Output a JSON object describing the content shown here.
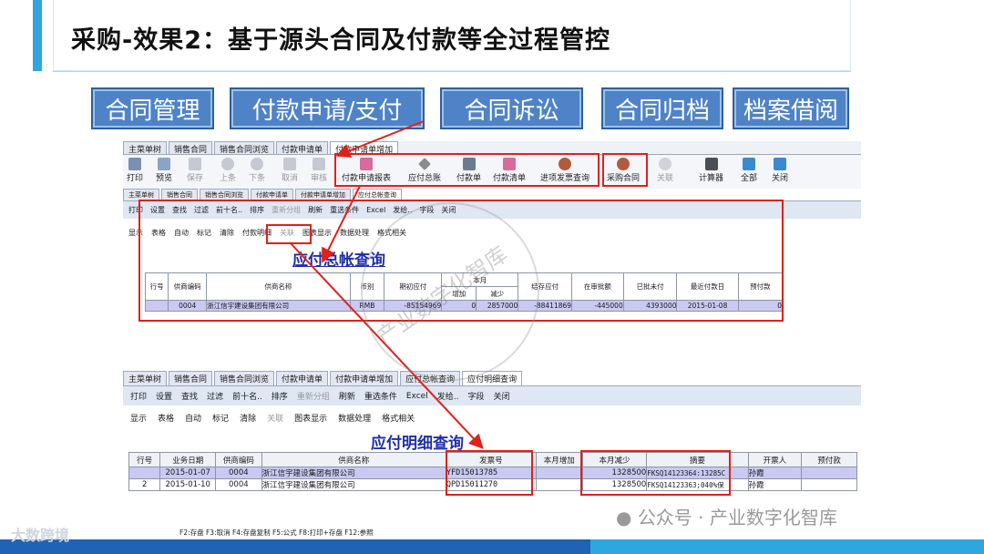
{
  "title": "采购-效果2：基于源头合同及付款等全过程管控",
  "modules": [
    "合同管理",
    "付款申请/支付",
    "合同诉讼",
    "合同归档",
    "档案借阅"
  ],
  "win1": {
    "tabs": [
      "主菜单树",
      "销售合同",
      "销售合同浏览",
      "付款申请单",
      "付款申请单增加"
    ],
    "tools_left": [
      {
        "label": "打印",
        "dis": false
      },
      {
        "label": "预览",
        "dis": false
      },
      {
        "label": "保存",
        "dis": true
      },
      {
        "label": "上条",
        "dis": true
      },
      {
        "label": "下条",
        "dis": true
      },
      {
        "label": "取消",
        "dis": true
      },
      {
        "label": "审核",
        "dis": true
      }
    ],
    "tools_group": [
      "付款申请报表",
      "应付总账",
      "付款单",
      "付款清单",
      "进项发票查询"
    ],
    "tool_purchase": "采购合同",
    "tools_right": [
      "关联",
      "计算器",
      "全部",
      "关闭"
    ]
  },
  "win2": {
    "tabs": [
      "主菜单树",
      "销售合同",
      "销售合同浏览",
      "付款申请单",
      "付款申请单增加",
      "应付总帐查询"
    ],
    "toolbar1": [
      "打印",
      "设置",
      "查找",
      "过滤",
      "前十名..",
      "排序",
      "重新分组",
      "刷新",
      "重选条件",
      "Excel",
      "发给..",
      "字段",
      "关闭"
    ],
    "toolbar2": [
      "显示",
      "表格",
      "自动",
      "标记",
      "清除",
      "付款明细",
      "关联",
      "图表显示",
      "数据处理",
      "格式相关"
    ],
    "heading": "应付总帐查询",
    "columns": [
      "行号",
      "供商编码",
      "供商名称",
      "币别",
      "期初应付",
      "本月",
      "结存应付",
      "在审批额",
      "已批未付",
      "最近付款日",
      "预付款"
    ],
    "subcolumns": [
      "增加",
      "减少"
    ],
    "row": [
      "",
      "0004",
      "浙江信宇建设集团有限公司",
      "RMB",
      "-85154969",
      "0",
      "2857000",
      "-88411869",
      "-445000",
      "4393000",
      "2015-01-08",
      "0"
    ]
  },
  "win3": {
    "tabs": [
      "主菜单树",
      "销售合同",
      "销售合同浏览",
      "付款申请单",
      "付款申请单增加",
      "应付总帐查询",
      "应付明细查询"
    ],
    "toolbar1": [
      "打印",
      "设置",
      "查找",
      "过滤",
      "前十名..",
      "排序",
      "重新分组",
      "刷新",
      "重选条件",
      "Excel",
      "发给..",
      "字段",
      "关闭"
    ],
    "toolbar2": [
      "显示",
      "表格",
      "自动",
      "标记",
      "清除",
      "关联",
      "图表显示",
      "数据处理",
      "格式相关"
    ],
    "heading": "应付明细查询",
    "columns": [
      "行号",
      "业务日期",
      "供商编码",
      "供商名称",
      "发票号",
      "本月增加",
      "本月减少",
      "摘要",
      "开票人",
      "预付款"
    ],
    "rows": [
      [
        "",
        "2015-01-07",
        "0004",
        "浙江信宇建设集团有限公司",
        "YFD15013785",
        "",
        "1328500",
        "FKSQ14123364:13285C",
        "孙霞",
        ""
      ],
      [
        "2",
        "2015-01-10",
        "0004",
        "浙江信宇建设集团有限公司",
        "QPD15011270",
        "",
        "1328500",
        "FKSQ14123363;040%保",
        "孙霞",
        ""
      ]
    ],
    "statusbar": "F2:存盘 F3:取消 F4:存盘复制 F5:公式 F8:打印+存盘 F12:参照"
  },
  "watermark": "产业数字化智库",
  "footer_wechat": "公众号 · 产业数字化智库",
  "footer_brand": "大数跨境",
  "colors": {
    "accent": "#2ea7e0",
    "module_bg": "#4f83c7",
    "red": "#e0201b",
    "heading": "#1f2fa8"
  }
}
